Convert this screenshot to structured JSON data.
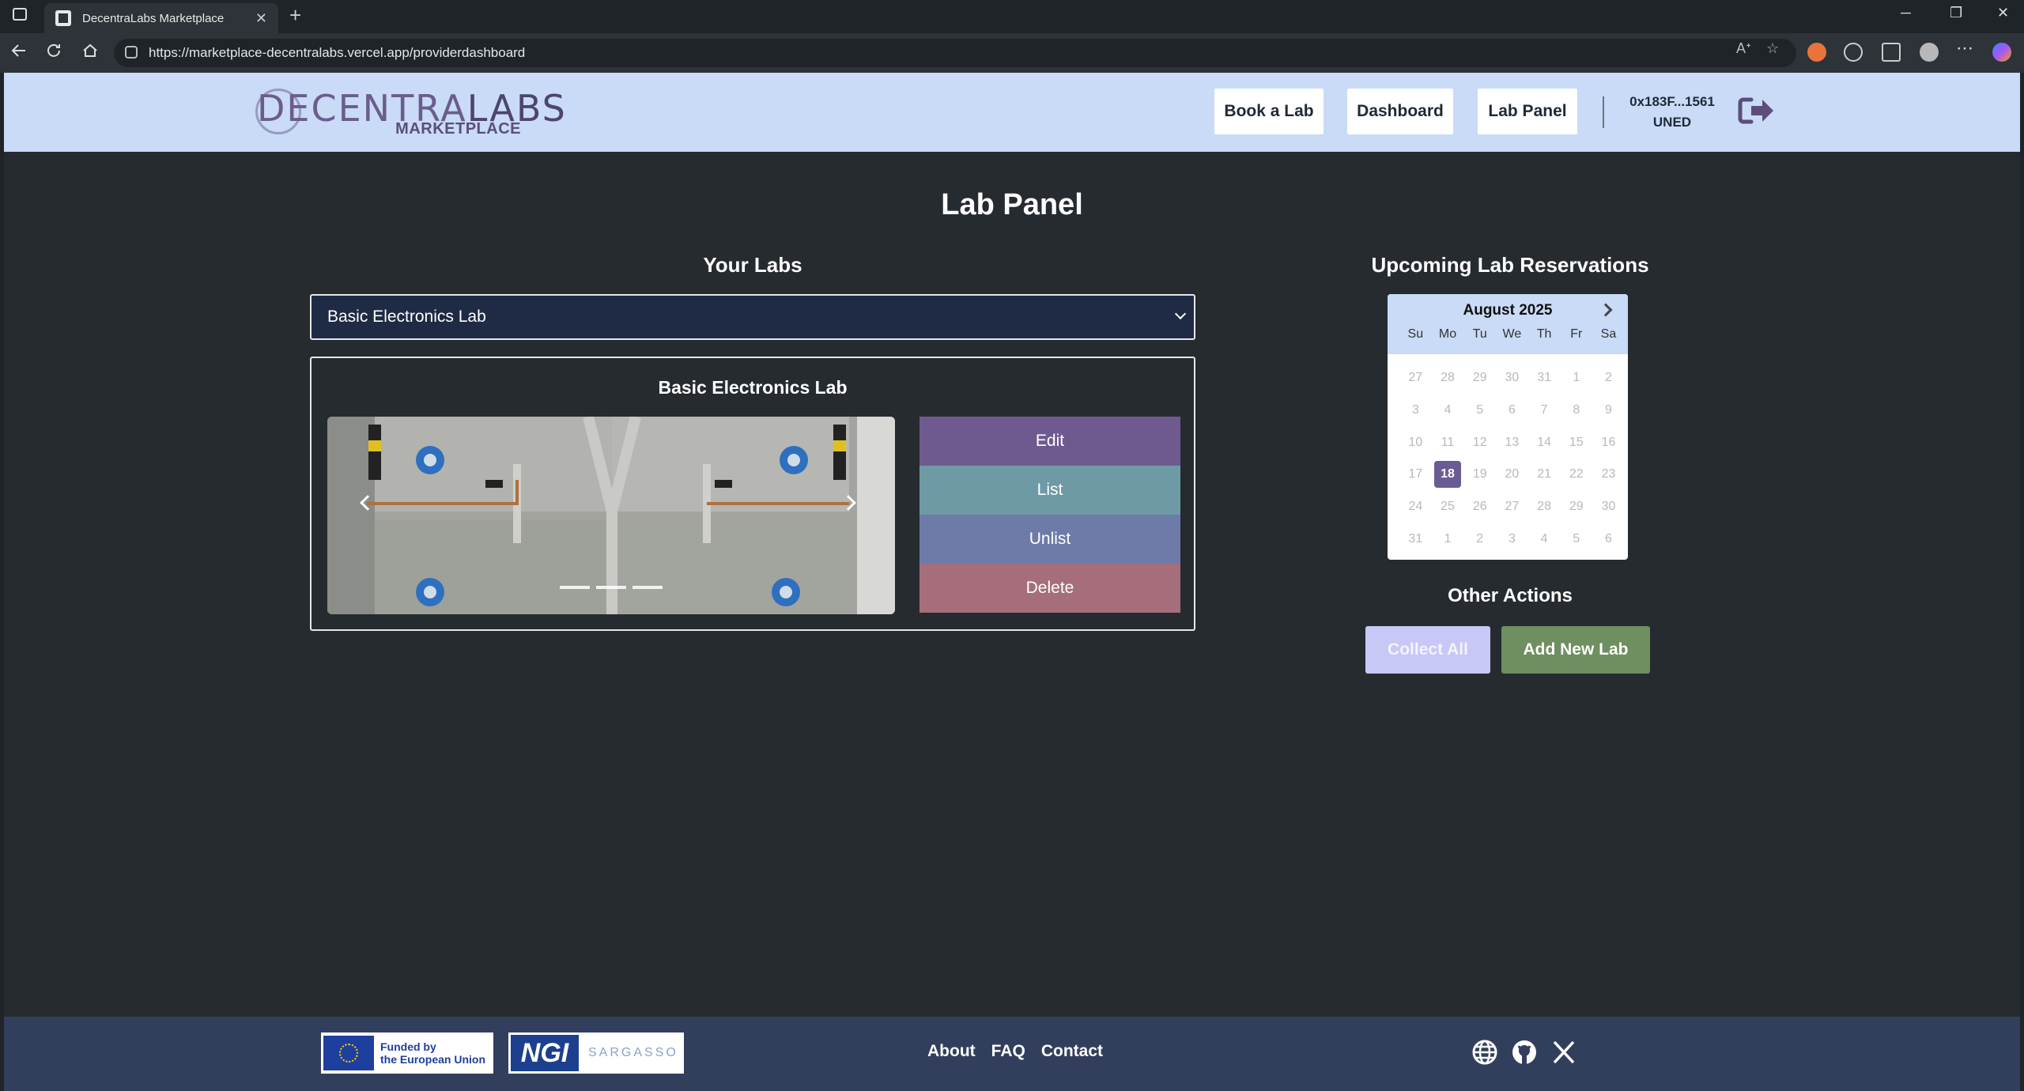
{
  "browser": {
    "tab_title": "DecentraLabs Marketplace",
    "tab_close": "✕",
    "new_tab": "+",
    "url": "https://marketplace-decentralabs.vercel.app/providerdashboard",
    "win_minimize": "─",
    "win_restore": "❐",
    "win_close": "✕"
  },
  "header": {
    "logo_main_left": "DECENTRA",
    "logo_main_right": "LABS",
    "logo_sub": "MARKETPLACE",
    "nav": {
      "book_label": "Book a Lab",
      "dashboard_label": "Dashboard",
      "lab_panel_label": "Lab Panel"
    },
    "wallet_address": "0x183F...1561",
    "institution": "UNED"
  },
  "main": {
    "page_title": "Lab Panel",
    "your_labs": {
      "title": "Your Labs",
      "selected_lab": "Basic Electronics Lab",
      "card_title": "Basic Electronics Lab",
      "carousel_slides": 3,
      "actions": {
        "edit": "Edit",
        "list": "List",
        "unlist": "Unlist",
        "delete": "Delete"
      }
    },
    "reservations": {
      "title": "Upcoming Lab Reservations",
      "month": "August 2025",
      "dows": [
        "Su",
        "Mo",
        "Tu",
        "We",
        "Th",
        "Fr",
        "Sa"
      ],
      "days": [
        "27",
        "28",
        "29",
        "30",
        "31",
        "1",
        "2",
        "3",
        "4",
        "5",
        "6",
        "7",
        "8",
        "9",
        "10",
        "11",
        "12",
        "13",
        "14",
        "15",
        "16",
        "17",
        "18",
        "19",
        "20",
        "21",
        "22",
        "23",
        "24",
        "25",
        "26",
        "27",
        "28",
        "29",
        "30",
        "31",
        "1",
        "2",
        "3",
        "4",
        "5",
        "6"
      ],
      "selected_day": "18"
    },
    "other_actions": {
      "title": "Other Actions",
      "collect_all": "Collect All",
      "add_new_lab": "Add New Lab"
    }
  },
  "footer": {
    "eu_line1": "Funded by",
    "eu_line2": "the European Union",
    "ngi_logo": "NGI",
    "ngi_text": "SARGASSO",
    "links": {
      "about": "About",
      "faq": "FAQ",
      "contact": "Contact"
    },
    "social_icons": [
      "globe-icon",
      "github-icon",
      "x-icon"
    ]
  },
  "colors": {
    "header_bg": "#c9dbf7",
    "main_bg": "#262b30",
    "footer_bg": "#323f5c",
    "edit_btn": "#6f5a90",
    "list_btn": "#6e9aa6",
    "unlist_btn": "#6e7ba9",
    "delete_btn": "#a66e7b",
    "add_lab_btn": "#6e8f5f",
    "collect_btn": "#c7c8f5"
  }
}
